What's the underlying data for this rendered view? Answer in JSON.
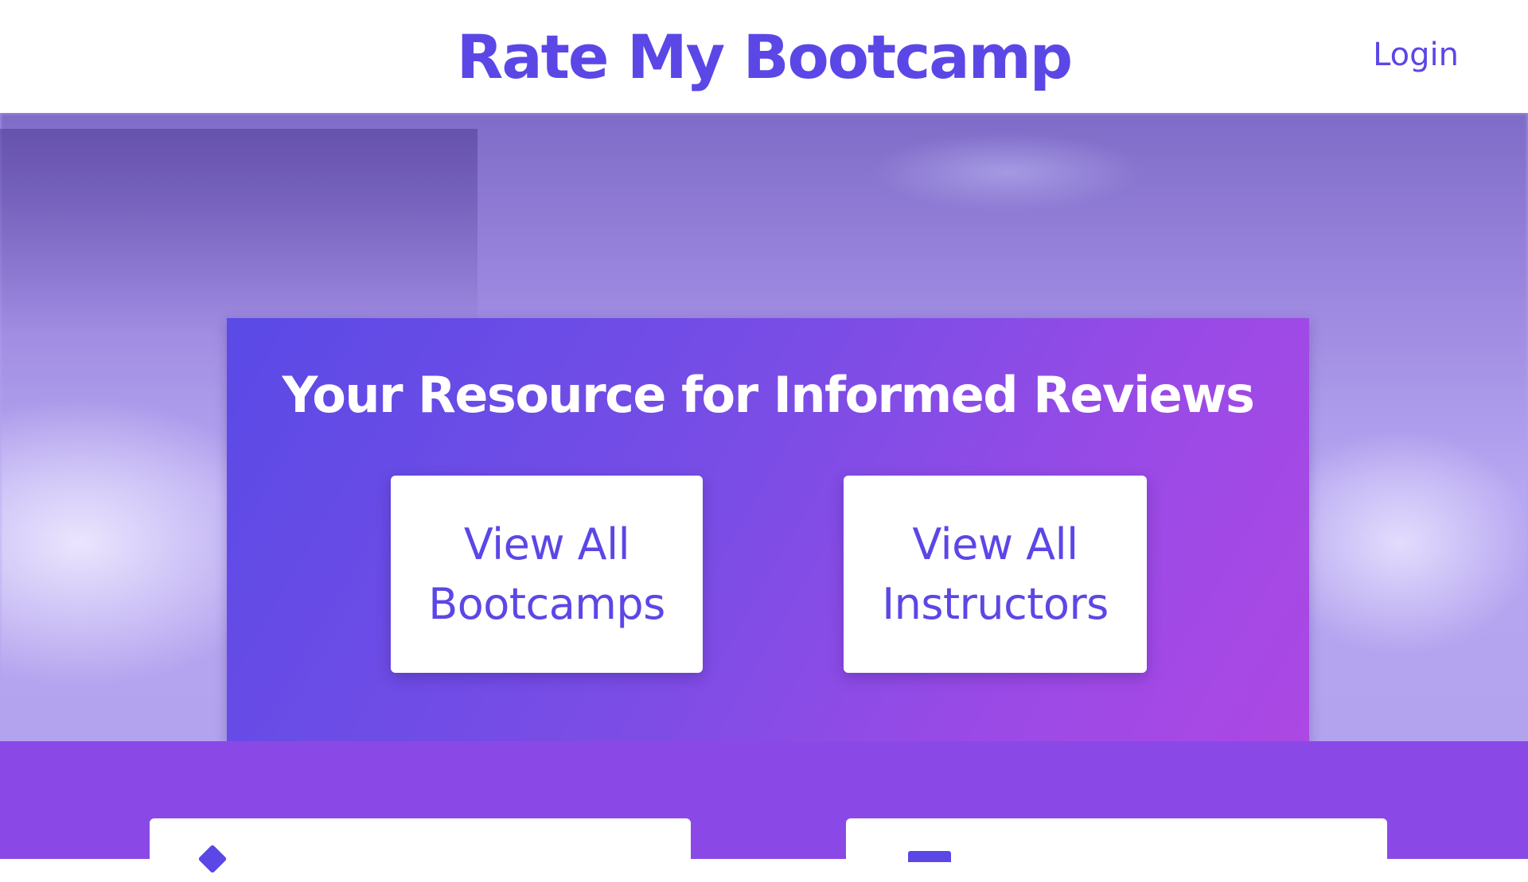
{
  "header": {
    "brand": "Rate My Bootcamp",
    "login_label": "Login"
  },
  "hero": {
    "title": "Your Resource for Informed Reviews",
    "buttons": [
      {
        "label": "View All Bootcamps"
      },
      {
        "label": "View All Instructors"
      }
    ]
  },
  "colors": {
    "brand_purple": "#5b47e6",
    "card_gradient_start": "#5a4ae6",
    "card_gradient_end": "#ad48e4",
    "lower_section": "#8a49e6"
  },
  "icons": {
    "lower_left": "feature-icon",
    "lower_right": "feature-icon"
  }
}
